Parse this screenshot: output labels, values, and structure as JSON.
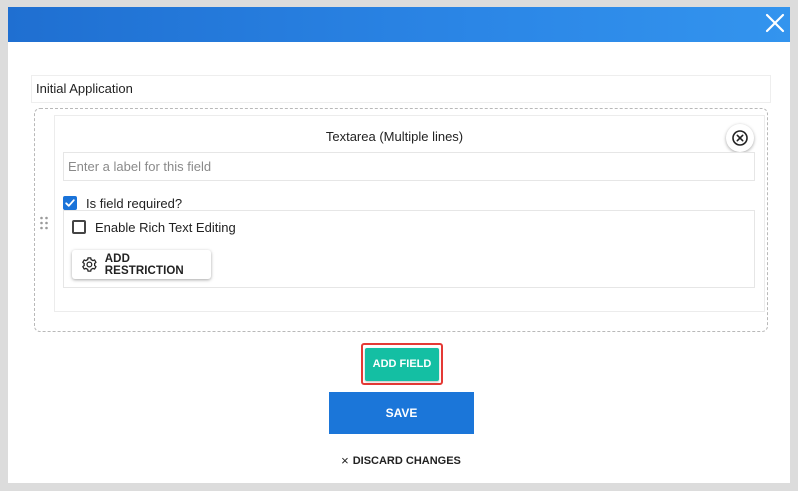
{
  "header": {
    "close_icon": "close-icon",
    "color_left": "#1f6fd1",
    "color_right": "#3394ee"
  },
  "form": {
    "title_value": "Initial Application"
  },
  "field_card": {
    "type_title": "Textarea (Multiple lines)",
    "remove_icon": "circle-x-icon",
    "label_placeholder": "Enter a label for this field",
    "label_value": "",
    "required_label": "Is field required?",
    "required_checked": true,
    "rich_text_label": "Enable Rich Text Editing",
    "rich_text_checked": false,
    "restriction_button": "ADD RESTRICTION",
    "restriction_icon": "gear-icon",
    "drag_icon": "drag-handle-icon"
  },
  "actions": {
    "add_field": "ADD FIELD",
    "save": "SAVE",
    "discard": "DISCARD CHANGES",
    "discard_icon": "×"
  },
  "colors": {
    "add_field_bg": "#14bfa3",
    "save_bg": "#1b76d9",
    "highlight": "#e53935",
    "checkbox_checked": "#1a73d9"
  }
}
